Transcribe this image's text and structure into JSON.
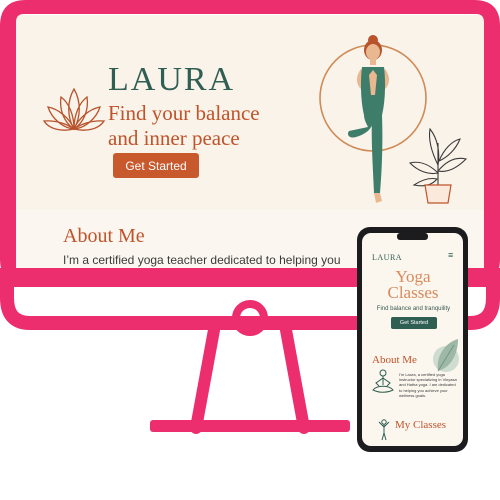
{
  "colors": {
    "frame": "#ec2d6e",
    "primary_green": "#2f5e52",
    "accent_terracotta": "#c8592d",
    "background": "#f9f3ea"
  },
  "desktop": {
    "brand": "LAURA",
    "tagline_line1": "Find your balance",
    "tagline_line2": "and inner peace",
    "cta_label": "Get Started",
    "about_heading": "About Me",
    "about_text": "I’m a certified yoga teacher dedicated to helping you achieve physical and mental well-being."
  },
  "mobile": {
    "brand": "LAURA",
    "title": "Yoga Classes",
    "subtitle": "Find balance and tranquility",
    "cta_label": "Get Started",
    "about_heading": "About Me",
    "about_text": "I'm Laura, a certified yoga instructor specializing in Vinyasa and Hatha yoga. I am dedicated to helping you achieve your wellness goals.",
    "classes_heading": "My Classes"
  },
  "icons": [
    "lotus-icon",
    "yoga-pose-illustration",
    "potted-plant-icon",
    "hamburger-menu-icon",
    "leaf-icon",
    "meditation-icon",
    "standing-yoga-icon"
  ]
}
